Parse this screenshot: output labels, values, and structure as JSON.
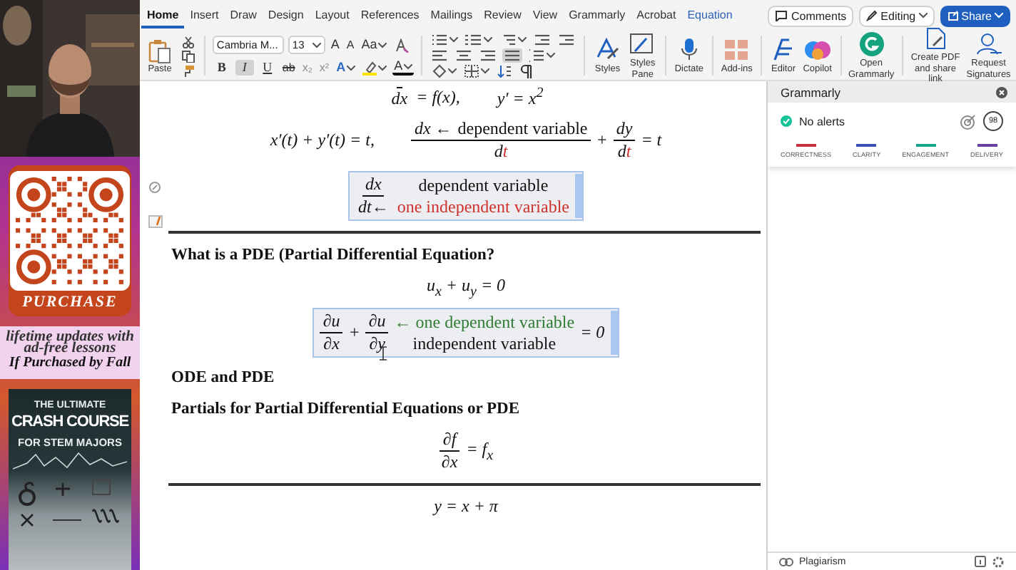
{
  "promo": {
    "qr_label": "PURCHASE",
    "lines": [
      "lifetime updates with",
      "ad-free lessons",
      "If Purchased by Fall"
    ],
    "poster_lines": [
      "THE ULTIMATE",
      "CRASH COURSE",
      "FOR STEM MAJORS"
    ]
  },
  "ribbon": {
    "tabs": [
      {
        "label": "Home",
        "selected": true,
        "kind": "standard"
      },
      {
        "label": "Insert",
        "selected": false,
        "kind": "standard"
      },
      {
        "label": "Draw",
        "selected": false,
        "kind": "standard"
      },
      {
        "label": "Design",
        "selected": false,
        "kind": "standard"
      },
      {
        "label": "Layout",
        "selected": false,
        "kind": "standard"
      },
      {
        "label": "References",
        "selected": false,
        "kind": "standard"
      },
      {
        "label": "Mailings",
        "selected": false,
        "kind": "standard"
      },
      {
        "label": "Review",
        "selected": false,
        "kind": "standard"
      },
      {
        "label": "View",
        "selected": false,
        "kind": "standard"
      },
      {
        "label": "Grammarly",
        "selected": false,
        "kind": "standard"
      },
      {
        "label": "Acrobat",
        "selected": false,
        "kind": "standard"
      },
      {
        "label": "Equation",
        "selected": false,
        "kind": "contextual"
      }
    ],
    "actions": [
      {
        "label": "Comments",
        "kind": "comments"
      },
      {
        "label": "Editing",
        "kind": "mode"
      },
      {
        "label": "Share",
        "kind": "share"
      }
    ],
    "paste_label": "Paste",
    "font_name": "Cambria M...",
    "font_size": "13",
    "letters": {
      "grow": "A",
      "shrink": "A",
      "change_case": "Aa",
      "strikethrough": "ab",
      "subscript": "x₂",
      "superscript": "x²",
      "text_effects": "A",
      "font_color": "A"
    },
    "format_buttons": [
      {
        "label": "B",
        "kind": "bold",
        "pressed": false
      },
      {
        "label": "I",
        "kind": "italic",
        "pressed": true
      },
      {
        "label": "U",
        "kind": "underline",
        "pressed": false
      }
    ],
    "alignments": [
      {
        "selected": false
      },
      {
        "selected": false
      },
      {
        "selected": false
      },
      {
        "selected": true
      }
    ],
    "large_buttons": [
      "Styles",
      "Styles Pane",
      "Dictate",
      "Add-ins",
      "Editor",
      "Copilot",
      "Open Grammarly",
      "Create PDF and share link",
      "Request Signatures"
    ]
  },
  "document": {
    "blocks": [
      {
        "kind": "equation",
        "selected": false,
        "parts": [
          {
            "kind": "frac",
            "den": [
              {
                "kind": "math",
                "text": "dx"
              }
            ]
          },
          {
            "kind": "math",
            "text": "= f(x),",
            "gap_after": true
          },
          {
            "kind": "math",
            "text": "y′ = x$^{2}$"
          }
        ]
      },
      {
        "kind": "equation",
        "selected": false,
        "parts": [
          {
            "kind": "math",
            "text": "x′(t) + y′(t) = t,",
            "gap_after": true
          },
          {
            "kind": "frac",
            "num": [
              {
                "kind": "math",
                "text": "dx ←"
              },
              {
                "kind": "word",
                "text": "dependent variable"
              }
            ],
            "den": [
              {
                "kind": "math",
                "text": "d"
              },
              {
                "kind": "math",
                "text": "t",
                "color": "#d0312d"
              }
            ]
          },
          {
            "kind": "math",
            "text": "+"
          },
          {
            "kind": "frac",
            "num": [
              {
                "kind": "math",
                "text": "dy"
              }
            ],
            "den": [
              {
                "kind": "math",
                "text": "d"
              },
              {
                "kind": "math",
                "text": "t",
                "color": "#d0312d"
              }
            ]
          },
          {
            "kind": "math",
            "text": "= t"
          }
        ]
      },
      {
        "kind": "equation",
        "selected": true,
        "parts": [
          {
            "kind": "frac",
            "num": [
              {
                "kind": "math",
                "text": "dx"
              }
            ],
            "den": [
              {
                "kind": "math",
                "text": "dt←"
              }
            ]
          },
          {
            "kind": "stack",
            "rows": [
              [
                {
                  "kind": "word",
                  "text": "dependent variable"
                }
              ],
              [
                {
                  "kind": "word",
                  "text": "one independent variable",
                  "color": "#d0312d"
                }
              ]
            ]
          }
        ]
      },
      {
        "kind": "rule"
      },
      {
        "kind": "paragraph",
        "text": "What is a PDE (Partial Differential Equation?"
      },
      {
        "kind": "equation",
        "selected": false,
        "parts": [
          {
            "kind": "math",
            "text": "u$_{x}$ + u$_{y}$ = 0"
          }
        ]
      },
      {
        "kind": "equation",
        "selected": true,
        "parts": [
          {
            "kind": "frac",
            "num": [
              {
                "kind": "math",
                "text": "∂u"
              }
            ],
            "den": [
              {
                "kind": "math",
                "text": "∂x"
              }
            ]
          },
          {
            "kind": "math",
            "text": "+"
          },
          {
            "kind": "frac",
            "num": [
              {
                "kind": "math",
                "text": "∂u"
              }
            ],
            "den": [
              {
                "kind": "math",
                "text": "∂y"
              }
            ]
          },
          {
            "kind": "stack",
            "rows": [
              [
                {
                  "kind": "word",
                  "text": "← one dependent variable",
                  "color": "#2e7d32"
                }
              ],
              [
                {
                  "kind": "word",
                  "text": "independent variable"
                }
              ]
            ]
          },
          {
            "kind": "math",
            "text": "= 0"
          }
        ]
      },
      {
        "kind": "paragraph",
        "text": "ODE and PDE"
      },
      {
        "kind": "paragraph",
        "text": "Partials for Partial Differential Equations or PDE"
      },
      {
        "kind": "equation",
        "selected": false,
        "parts": [
          {
            "kind": "frac",
            "num": [
              {
                "kind": "math",
                "text": "∂f"
              }
            ],
            "den": [
              {
                "kind": "math",
                "text": "∂x"
              }
            ]
          },
          {
            "kind": "math",
            "text": "= f$_{x}$"
          }
        ]
      },
      {
        "kind": "rule"
      },
      {
        "kind": "equation",
        "selected": false,
        "parts": [
          {
            "kind": "math",
            "text": "y = x + π"
          }
        ]
      }
    ]
  },
  "grammarly": {
    "title": "Grammarly",
    "status": "No alerts",
    "score": "98",
    "categories": [
      {
        "label": "CORRECTNESS",
        "color": "#c8323f"
      },
      {
        "label": "CLARITY",
        "color": "#3a4fb4"
      },
      {
        "label": "ENGAGEMENT",
        "color": "#17a589"
      },
      {
        "label": "DELIVERY",
        "color": "#6a3fa3"
      }
    ],
    "footer": "Plagiarism"
  }
}
